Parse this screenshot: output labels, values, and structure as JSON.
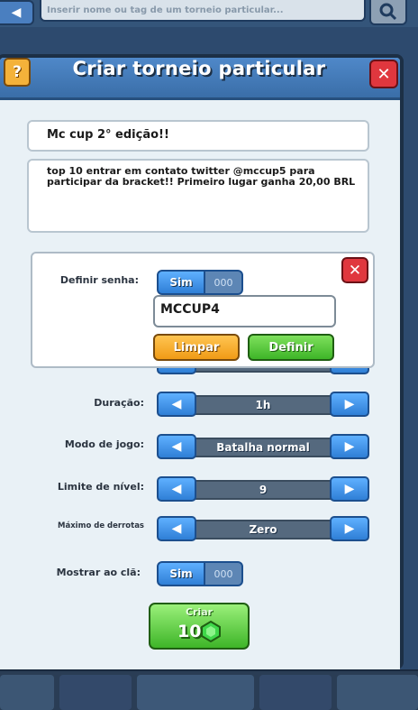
{
  "top_bar": {
    "back_icon": "back-arrow-icon",
    "search_placeholder": "Inserir nome ou tag de um torneio particular...",
    "search_icon": "magnifier-icon"
  },
  "modal": {
    "title": "Criar torneio particular",
    "help_label": "?",
    "close_label": "✕",
    "name_value": "Mc cup 2° edição!!",
    "description_value": "top 10 entrar em contato twitter @mccup5 para participar da bracket!! Primeiro lugar ganha 20,00 BRL",
    "rows": [
      {
        "label": "Duração:",
        "value": "1h"
      },
      {
        "label": "Modo de jogo:",
        "value": "Batalha normal"
      },
      {
        "label": "Limite de nível:",
        "value": "9"
      },
      {
        "label": "Máximo de derrotas",
        "value": "Zero"
      }
    ],
    "show_clan": {
      "label": "Mostrar ao clã:",
      "on_label": "Sim",
      "off_label": "000"
    },
    "create": {
      "label": "Criar",
      "cost": "10",
      "icon": "gem-icon"
    }
  },
  "password_popup": {
    "label": "Definir senha:",
    "toggle_on": "Sim",
    "toggle_off": "000",
    "password_value": "MCCUP4",
    "close_label": "✕",
    "clear_label": "Limpar",
    "set_label": "Definir"
  },
  "colors": {
    "accent_blue": "#2f7fd6",
    "close_red": "#e0373e",
    "confirm_green": "#3eb528",
    "clear_orange": "#f09b16"
  }
}
